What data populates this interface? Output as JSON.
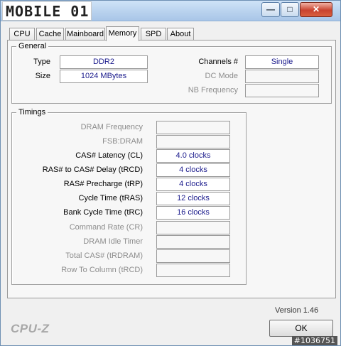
{
  "window": {
    "logo_text": "MOBILE 01",
    "minimize_glyph": "—",
    "maximize_glyph": "□",
    "close_glyph": "✕"
  },
  "tabs": [
    {
      "label": "CPU"
    },
    {
      "label": "Cache"
    },
    {
      "label": "Mainboard"
    },
    {
      "label": "Memory",
      "active": true
    },
    {
      "label": "SPD"
    },
    {
      "label": "About"
    }
  ],
  "general": {
    "title": "General",
    "type_label": "Type",
    "type_value": "DDR2",
    "size_label": "Size",
    "size_value": "1024 MBytes",
    "channels_label": "Channels #",
    "channels_value": "Single",
    "dc_mode_label": "DC Mode",
    "dc_mode_value": "",
    "nb_freq_label": "NB Frequency",
    "nb_freq_value": ""
  },
  "timings": {
    "title": "Timings",
    "rows": [
      {
        "label": "DRAM Frequency",
        "value": "",
        "enabled": false
      },
      {
        "label": "FSB:DRAM",
        "value": "",
        "enabled": false
      },
      {
        "label": "CAS# Latency (CL)",
        "value": "4.0 clocks",
        "enabled": true
      },
      {
        "label": "RAS# to CAS# Delay (tRCD)",
        "value": "4 clocks",
        "enabled": true
      },
      {
        "label": "RAS# Precharge (tRP)",
        "value": "4 clocks",
        "enabled": true
      },
      {
        "label": "Cycle Time (tRAS)",
        "value": "12 clocks",
        "enabled": true
      },
      {
        "label": "Bank Cycle Time (tRC)",
        "value": "16 clocks",
        "enabled": true
      },
      {
        "label": "Command Rate (CR)",
        "value": "",
        "enabled": false
      },
      {
        "label": "DRAM Idle Timer",
        "value": "",
        "enabled": false
      },
      {
        "label": "Total CAS# (tRDRAM)",
        "value": "",
        "enabled": false
      },
      {
        "label": "Row To Column (tRCD)",
        "value": "",
        "enabled": false
      }
    ]
  },
  "footer": {
    "brand": "CPU-Z",
    "version": "Version 1.46",
    "ok_label": "OK",
    "watermark": "#1036751"
  }
}
